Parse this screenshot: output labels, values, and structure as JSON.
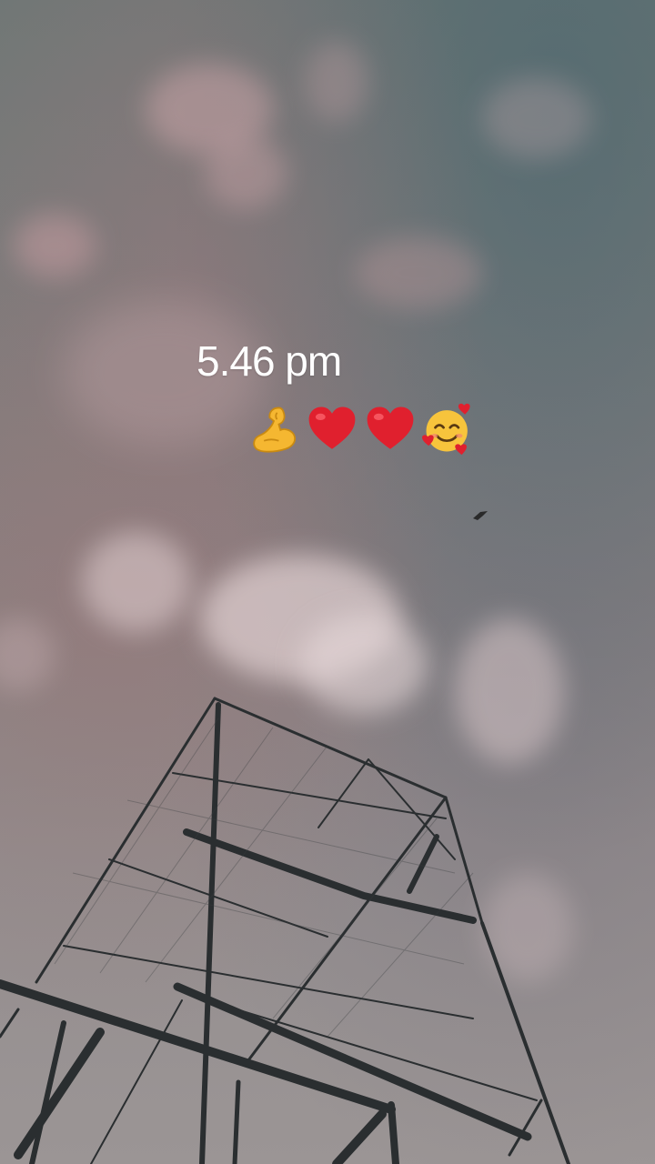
{
  "story": {
    "time_text": "5.46 pm",
    "emojis": [
      {
        "name": "flexed-biceps-icon",
        "color": "#f5b731"
      },
      {
        "name": "red-heart-icon",
        "color": "#e0202e"
      },
      {
        "name": "red-heart-icon",
        "color": "#e0202e"
      },
      {
        "name": "smiling-face-with-hearts-icon",
        "color": "#f7c43c"
      }
    ]
  }
}
